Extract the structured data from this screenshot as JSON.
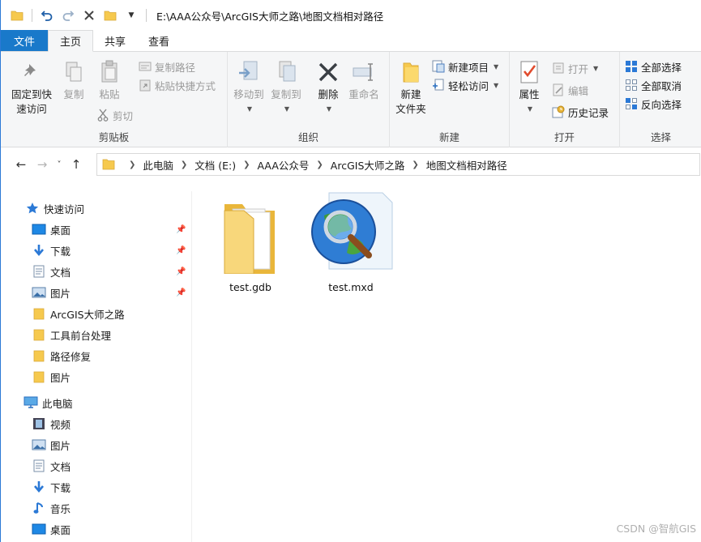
{
  "window": {
    "title_path": "E:\\AAA公众号\\ArcGIS大师之路\\地图文档相对路径"
  },
  "tabs": [
    {
      "label": "文件"
    },
    {
      "label": "主页"
    },
    {
      "label": "共享"
    },
    {
      "label": "查看"
    }
  ],
  "ribbon": {
    "clipboard": {
      "pin_quick": "固定到快\n速访问",
      "pin_quick_line1": "固定到快",
      "pin_quick_line2": "速访问",
      "copy": "复制",
      "paste": "粘贴",
      "copy_path": "复制路径",
      "paste_shortcut": "粘贴快捷方式",
      "cut": "剪切",
      "label": "剪贴板"
    },
    "organize": {
      "move_to": "移动到",
      "copy_to": "复制到",
      "delete": "删除",
      "rename": "重命名",
      "label": "组织"
    },
    "new": {
      "new_folder_line1": "新建",
      "new_folder_line2": "文件夹",
      "new_item": "新建项目",
      "easy_access": "轻松访问",
      "label": "新建"
    },
    "open": {
      "properties": "属性",
      "open": "打开",
      "edit": "编辑",
      "history": "历史记录",
      "label": "打开"
    },
    "select": {
      "select_all": "全部选择",
      "select_none": "全部取消",
      "invert": "反向选择",
      "label": "选择"
    }
  },
  "address": {
    "crumbs": [
      "此电脑",
      "文档 (E:)",
      "AAA公众号",
      "ArcGIS大师之路",
      "地图文档相对路径"
    ]
  },
  "nav": {
    "quick_access": "快速访问",
    "quick_items": [
      {
        "label": "桌面",
        "icon": "desktop-icon",
        "pinned": true
      },
      {
        "label": "下载",
        "icon": "download-icon",
        "pinned": true
      },
      {
        "label": "文档",
        "icon": "document-icon",
        "pinned": true
      },
      {
        "label": "图片",
        "icon": "pictures-icon",
        "pinned": true
      },
      {
        "label": "ArcGIS大师之路",
        "icon": "folder-icon",
        "pinned": false
      },
      {
        "label": "工具前台处理",
        "icon": "folder-icon",
        "pinned": false
      },
      {
        "label": "路径修复",
        "icon": "folder-icon",
        "pinned": false
      },
      {
        "label": "图片",
        "icon": "folder-icon",
        "pinned": false
      }
    ],
    "this_pc": "此电脑",
    "pc_items": [
      {
        "label": "视频",
        "icon": "video-icon"
      },
      {
        "label": "图片",
        "icon": "pictures-icon"
      },
      {
        "label": "文档",
        "icon": "document-icon"
      },
      {
        "label": "下载",
        "icon": "download-icon"
      },
      {
        "label": "音乐",
        "icon": "music-icon"
      },
      {
        "label": "桌面",
        "icon": "desktop-icon"
      }
    ]
  },
  "files": [
    {
      "name": "test.gdb",
      "icon": "gdb-folder-icon"
    },
    {
      "name": "test.mxd",
      "icon": "mxd-file-icon"
    }
  ],
  "watermark": "CSDN @智航GIS",
  "colors": {
    "accent": "#1979ca",
    "folder": "#f6c94e",
    "ribbon_bg": "#f5f6f7"
  }
}
